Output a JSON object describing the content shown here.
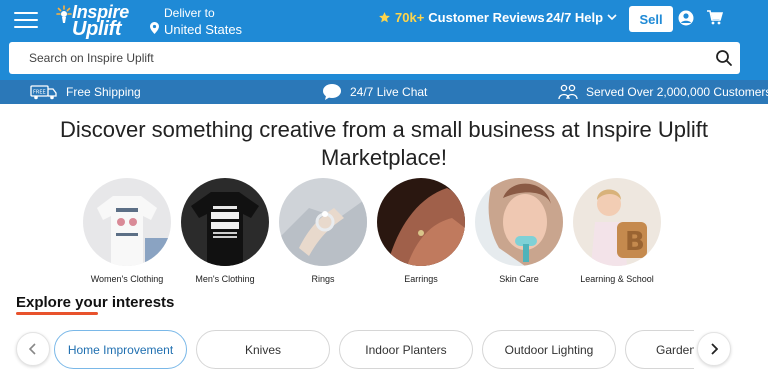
{
  "header": {
    "logo_line1": "Inspire",
    "logo_line2": "Uplift",
    "deliver_label": "Deliver to",
    "deliver_location": "United States",
    "reviews_count": "70k+",
    "reviews_label": "Customer Reviews",
    "help_label": "24/7 Help",
    "sell_label": "Sell"
  },
  "search": {
    "placeholder": "Search on Inspire Uplift"
  },
  "banner": {
    "shipping": "Free Shipping",
    "chat": "24/7 Live Chat",
    "served": "Served Over 2,000,000 Customers"
  },
  "headline": "Discover something creative from a small business at Inspire Uplift Marketplace!",
  "categories": [
    {
      "label": "Women's Clothing"
    },
    {
      "label": "Men's Clothing"
    },
    {
      "label": "Rings"
    },
    {
      "label": "Earrings"
    },
    {
      "label": "Skin Care"
    },
    {
      "label": "Learning & School"
    }
  ],
  "explore": {
    "title": "Explore your interests",
    "pills": [
      "Home Improvement",
      "Knives",
      "Indoor Planters",
      "Outdoor Lighting",
      "Garden"
    ]
  },
  "colors": {
    "header_bg": "#1f8ad6",
    "banner_bg": "#2b78b8",
    "accent_underline": "#e8522c",
    "star": "#ffd54a"
  }
}
